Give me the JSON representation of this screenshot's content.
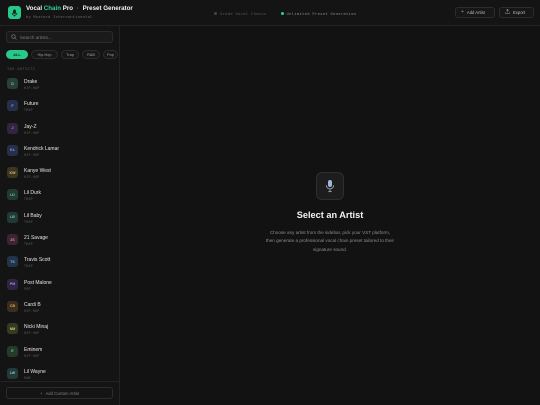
{
  "header": {
    "brand_part1": "Vocal",
    "brand_accent": "Chain",
    "brand_part2": "Pro",
    "separator": "·",
    "brand_suffix": "Preset Generator",
    "byline": "by Mustard Intercontinental",
    "pills": [
      {
        "label": "Grade Vocal Chains",
        "active": false
      },
      {
        "label": "Unlimited Preset Generation",
        "active": true
      }
    ],
    "add_artist_label": "Add Artist",
    "export_label": "Export"
  },
  "sidebar": {
    "search_placeholder": "Search artists...",
    "filters": [
      "ALL",
      "Hip-Hop",
      "Trap",
      "R&B",
      "Pop"
    ],
    "active_filter": "ALL",
    "count_label": "305 ARTISTS",
    "artists": [
      {
        "initials": "D",
        "name": "Drake",
        "genre": "HIP-HOP",
        "color": "#2a3f36",
        "text": "#7fd0a8"
      },
      {
        "initials": "F",
        "name": "Future",
        "genre": "TRAP",
        "color": "#26304a",
        "text": "#8ea3e0"
      },
      {
        "initials": "J",
        "name": "Jay-Z",
        "genre": "HIP-HOP",
        "color": "#33253f",
        "text": "#b790d8"
      },
      {
        "initials": "KL",
        "name": "Kendrick Lamar",
        "genre": "HIP-HOP",
        "color": "#26304a",
        "text": "#8ea3e0"
      },
      {
        "initials": "KW",
        "name": "Kanye West",
        "genre": "HIP-HOP",
        "color": "#3d3524",
        "text": "#d8b86e"
      },
      {
        "initials": "LD",
        "name": "Lil Durk",
        "genre": "TRAP",
        "color": "#223a30",
        "text": "#6fcf9c"
      },
      {
        "initials": "LB",
        "name": "Lil Baby",
        "genre": "TRAP",
        "color": "#213a35",
        "text": "#6fcfb4"
      },
      {
        "initials": "2S",
        "name": "21 Savage",
        "genre": "TRAP",
        "color": "#3c2432",
        "text": "#d98aae"
      },
      {
        "initials": "TS",
        "name": "Travis Scott",
        "genre": "TRAP",
        "color": "#22344a",
        "text": "#7fb0e0"
      },
      {
        "initials": "PM",
        "name": "Post Malone",
        "genre": "POP",
        "color": "#2e2542",
        "text": "#a48ee0"
      },
      {
        "initials": "CB",
        "name": "Cardi B",
        "genre": "HIP-HOP",
        "color": "#3b2e1f",
        "text": "#dba466"
      },
      {
        "initials": "NM",
        "name": "Nicki Minaj",
        "genre": "HIP-HOP",
        "color": "#363a22",
        "text": "#c4cf6f"
      },
      {
        "initials": "E",
        "name": "Eminem",
        "genre": "HIP-HOP",
        "color": "#243a2a",
        "text": "#7fcf8c"
      },
      {
        "initials": "LW",
        "name": "Lil Wayne",
        "genre": "R&B",
        "color": "#23393a",
        "text": "#7fcfc8"
      }
    ],
    "add_custom_label": "Add Custom Artist"
  },
  "main": {
    "title": "Select an Artist",
    "description": "Choose any artist from the sidebar, pick your VST platform, then generate a professional vocal chain preset tailored to their signature sound."
  },
  "colors": {
    "accent": "#27c98a",
    "background": "#141414"
  },
  "icons": {
    "logo": "mic-logo-icon",
    "search": "search-icon",
    "add": "plus-icon",
    "export": "export-icon",
    "empty_state": "microphone-icon"
  }
}
